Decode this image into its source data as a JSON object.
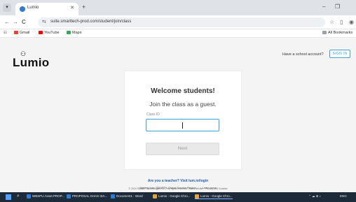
{
  "browser": {
    "tab_menu_icon": "chevron-down-icon",
    "tab_title": "Lumio",
    "tab_close": "✕",
    "new_tab": "+",
    "minimize": "–",
    "maximize": "❐",
    "back": "←",
    "forward": "→",
    "reload": "C",
    "site_info": "⇆",
    "url": "suite.smarttech-prod.com/student/join/class",
    "bookmark_star": "☆",
    "profile": "◉",
    "bookmarks": [
      {
        "label": "Gmail",
        "color": "#ea4335"
      },
      {
        "label": "YouTube",
        "color": "#ff0000"
      },
      {
        "label": "Maps",
        "color": "#34a853"
      }
    ],
    "all_bookmarks": "All Bookmarks"
  },
  "page": {
    "logo_text": "Lumio",
    "logo_tm": "™",
    "logo_mark": "⚇",
    "have_account": "Have a school account?",
    "sign_in": "SIGN IN",
    "welcome": "Welcome students!",
    "guest": "Join the class as a guest.",
    "class_id_label": "Class ID",
    "class_id_value": "",
    "next": "Next",
    "teacher_link": "Are you a teacher? Visit lum.io/login",
    "signing_in": "Signing into: SMART's Global Service Region — · Learn more",
    "copyright": "© 2024 SMART Technologies ULC. All rights reserved.   Terms of Use · Privacy and Cookies"
  },
  "taskbar": {
    "search_icon": "⌕",
    "apps": [
      {
        "label": "WBSPU Asset PROP...",
        "color": "#2b7cd3"
      },
      {
        "label": "PROPOSAL KHAS ISA...",
        "color": "#2b7cd3"
      },
      {
        "label": "Document1 - Word",
        "color": "#2b7cd3"
      },
      {
        "label": "Lumio - Google Chro...",
        "color": "#e8a33d"
      },
      {
        "label": "Lumio - Google Chro...",
        "color": "#e8a33d"
      }
    ],
    "tray_text": "ENG",
    "tray_icons": "⌃ ☁ ⊕ ♪"
  },
  "colors": {
    "accent": "#3ba3d9",
    "link": "#1f5db8",
    "page_bg": "#f4f4f4",
    "taskbar": "#1d2a3a"
  }
}
